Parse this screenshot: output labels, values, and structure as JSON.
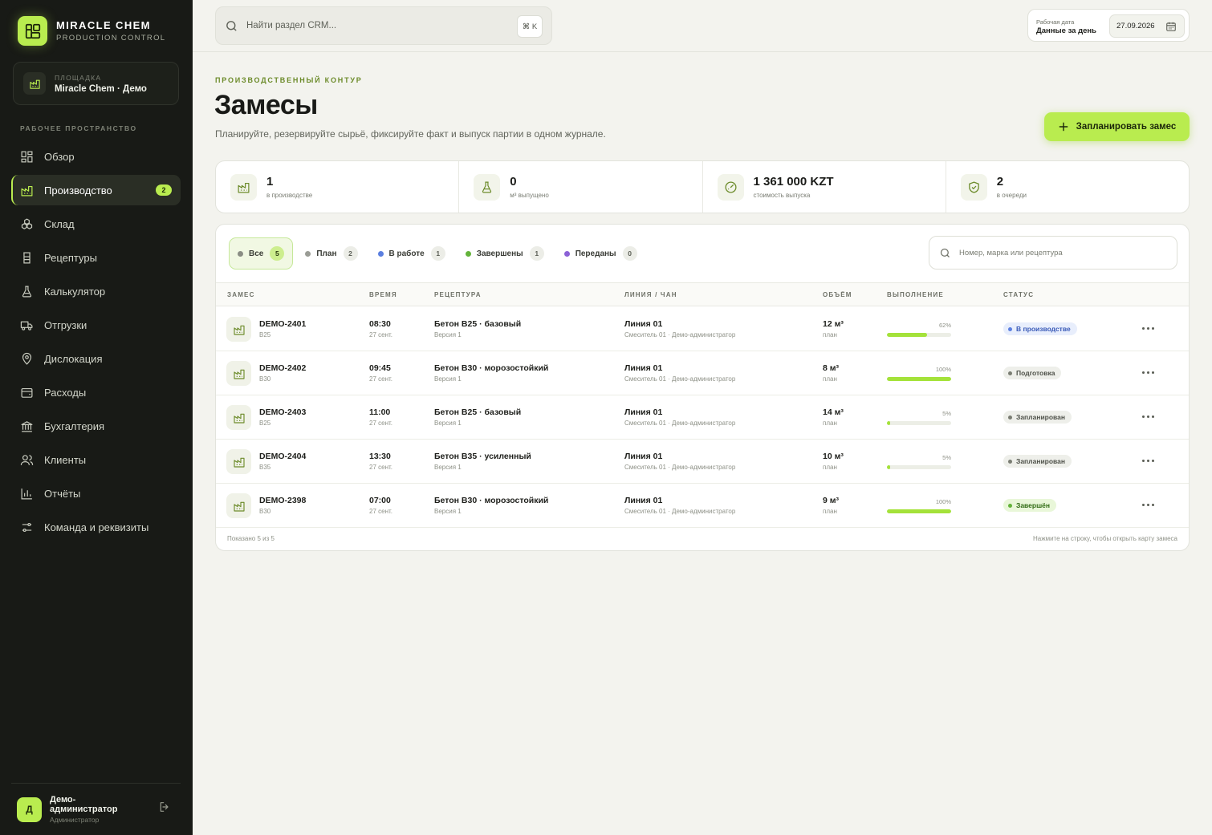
{
  "brand": {
    "title": "MIRACLE CHEM",
    "subtitle": "PRODUCTION CONTROL"
  },
  "site": {
    "label": "ПЛОЩАДКА",
    "name": "Miracle Chem · Демо"
  },
  "workspace_label": "РАБОЧЕЕ ПРОСТРАНСТВО",
  "nav": [
    {
      "label": "Обзор",
      "icon": "grid-icon"
    },
    {
      "label": "Производство",
      "icon": "factory-icon",
      "badge": "2",
      "active": true
    },
    {
      "label": "Склад",
      "icon": "boxes-icon"
    },
    {
      "label": "Рецептуры",
      "icon": "recipe-icon"
    },
    {
      "label": "Калькулятор",
      "icon": "flask-icon"
    },
    {
      "label": "Отгрузки",
      "icon": "truck-icon"
    },
    {
      "label": "Дислокация",
      "icon": "map-pin-icon"
    },
    {
      "label": "Расходы",
      "icon": "wallet-icon"
    },
    {
      "label": "Бухгалтерия",
      "icon": "bank-icon"
    },
    {
      "label": "Клиенты",
      "icon": "users-icon"
    },
    {
      "label": "Отчёты",
      "icon": "bar-chart-icon"
    },
    {
      "label": "Команда и реквизиты",
      "icon": "sliders-icon"
    }
  ],
  "user": {
    "initial": "Д",
    "name": "Демо-администратор",
    "role": "Администратор"
  },
  "topbar": {
    "search_placeholder": "Найти раздел CRM...",
    "shortcut": "⌘ K",
    "date_caption": "Рабочая дата",
    "date_mode": "Данные за день",
    "date_value": "27.09.2026"
  },
  "header": {
    "eyebrow": "ПРОИЗВОДСТВЕННЫЙ КОНТУР",
    "title": "Замесы",
    "description": "Планируйте, резервируйте сырьё, фиксируйте факт и выпуск партии в одном журнале.",
    "primary_button": "Запланировать замес"
  },
  "stats": [
    {
      "value": "1",
      "label": "в производстве",
      "icon": "factory-icon"
    },
    {
      "value": "0",
      "label": "м³ выпущено",
      "icon": "flask-icon"
    },
    {
      "value": "1 361 000 KZT",
      "label": "стоимость выпуска",
      "icon": "gauge-icon"
    },
    {
      "value": "2",
      "label": "в очереди",
      "icon": "shield-check-icon"
    }
  ],
  "filters": [
    {
      "label": "Все",
      "count": "5",
      "color": "#8a8d84",
      "active": true
    },
    {
      "label": "План",
      "count": "2",
      "color": "#9a9c95"
    },
    {
      "label": "В работе",
      "count": "1",
      "color": "#5b7fe0"
    },
    {
      "label": "Завершены",
      "count": "1",
      "color": "#63b33a"
    },
    {
      "label": "Переданы",
      "count": "0",
      "color": "#8b61d6"
    }
  ],
  "table_search_placeholder": "Номер, марка или рецептура",
  "columns": [
    "ЗАМЕС",
    "ВРЕМЯ",
    "РЕЦЕПТУРА",
    "ЛИНИЯ / ЧАН",
    "ОБЪЁМ",
    "ВЫПОЛНЕНИЕ",
    "СТАТУС"
  ],
  "rows": [
    {
      "id": "DEMO-2401",
      "grade": "B25",
      "time": "08:30",
      "date": "27 сент.",
      "recipe": "Бетон B25 · базовый",
      "version": "Версия 1",
      "line": "Линия 01",
      "line_sub": "Смеситель 01 · Демо-администратор",
      "volume": "12 м³",
      "volume_sub": "план",
      "progress_label": "62%",
      "progress": 62,
      "status": "В производстве",
      "status_style": "blue"
    },
    {
      "id": "DEMO-2402",
      "grade": "B30",
      "time": "09:45",
      "date": "27 сент.",
      "recipe": "Бетон B30 · морозостойкий",
      "version": "Версия 1",
      "line": "Линия 01",
      "line_sub": "Смеситель 01 · Демо-администратор",
      "volume": "8 м³",
      "volume_sub": "план",
      "progress_label": "100%",
      "progress": 100,
      "status": "Подготовка",
      "status_style": "gray"
    },
    {
      "id": "DEMO-2403",
      "grade": "B25",
      "time": "11:00",
      "date": "27 сент.",
      "recipe": "Бетон B25 · базовый",
      "version": "Версия 1",
      "line": "Линия 01",
      "line_sub": "Смеситель 01 · Демо-администратор",
      "volume": "14 м³",
      "volume_sub": "план",
      "progress_label": "5%",
      "progress": 5,
      "status": "Запланирован",
      "status_style": "gray"
    },
    {
      "id": "DEMO-2404",
      "grade": "B35",
      "time": "13:30",
      "date": "27 сент.",
      "recipe": "Бетон B35 · усиленный",
      "version": "Версия 1",
      "line": "Линия 01",
      "line_sub": "Смеситель 01 · Демо-администратор",
      "volume": "10 м³",
      "volume_sub": "план",
      "progress_label": "5%",
      "progress": 5,
      "status": "Запланирован",
      "status_style": "gray"
    },
    {
      "id": "DEMO-2398",
      "grade": "B30",
      "time": "07:00",
      "date": "27 сент.",
      "recipe": "Бетон B30 · морозостойкий",
      "version": "Версия 1",
      "line": "Линия 01",
      "line_sub": "Смеситель 01 · Демо-администратор",
      "volume": "9 м³",
      "volume_sub": "план",
      "progress_label": "100%",
      "progress": 100,
      "status": "Завершён",
      "status_style": "green"
    }
  ],
  "footer": {
    "shown": "Показано 5 из 5",
    "hint": "Нажмите на строку, чтобы открыть карту замеса"
  },
  "colors": {
    "accent": "#b9ec4f",
    "sidebar": "#181a16",
    "progress": "#a4e23a"
  }
}
